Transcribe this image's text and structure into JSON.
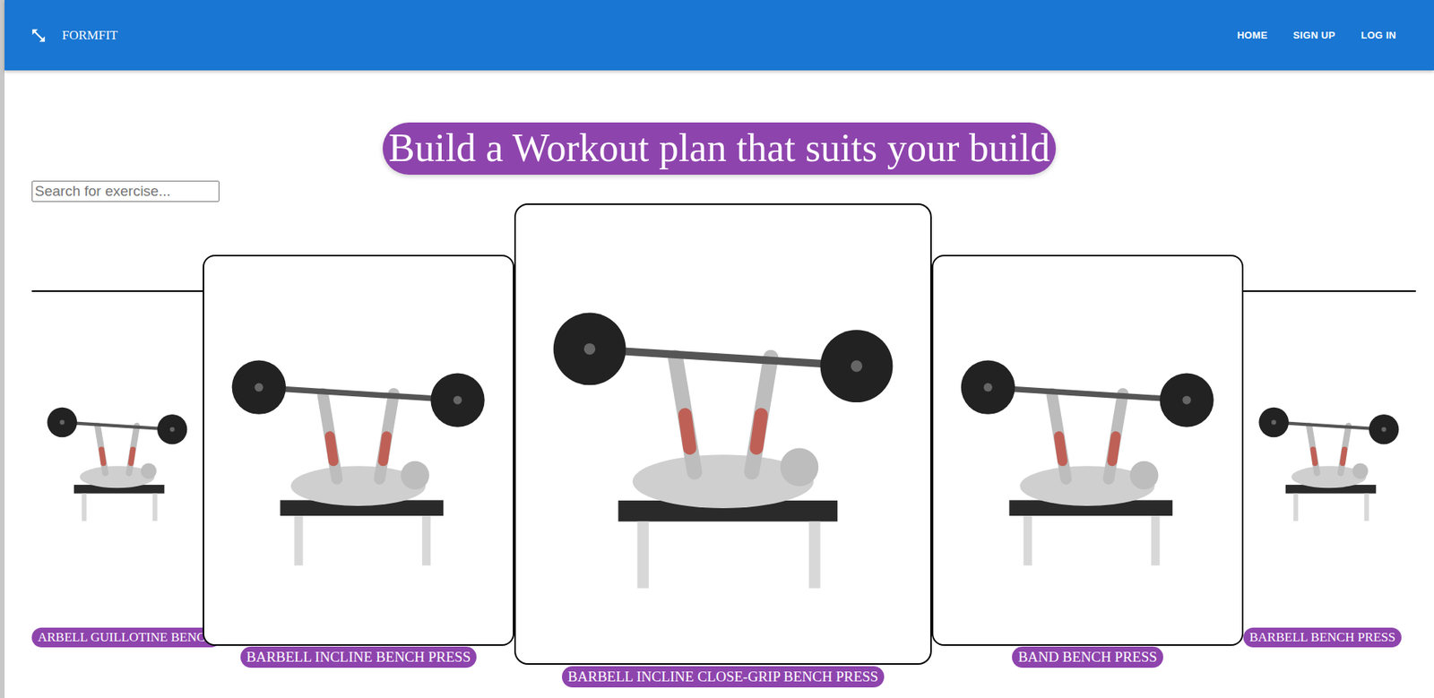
{
  "brand": "FORMFIT",
  "nav": [
    {
      "label": "HOME"
    },
    {
      "label": "SIGN UP"
    },
    {
      "label": "LOG IN"
    }
  ],
  "heading": "Build a Workout plan that suits your build",
  "search": {
    "placeholder": "Search for exercise..."
  },
  "exercises": [
    {
      "name": "ARBELL GUILLOTINE BENCH",
      "selected": false
    },
    {
      "name": "BARBELL INCLINE BENCH PRESS",
      "selected": false
    },
    {
      "name": "BARBELL INCLINE CLOSE-GRIP BENCH PRESS",
      "selected": true
    },
    {
      "name": "BAND BENCH PRESS",
      "selected": false
    },
    {
      "name": "BARBELL BENCH PRESS",
      "selected": false
    }
  ]
}
